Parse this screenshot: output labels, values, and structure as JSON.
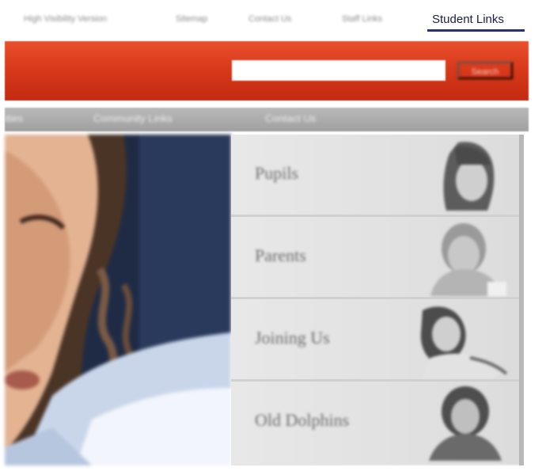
{
  "top_links": [
    {
      "label": "High Visibility Version"
    },
    {
      "label": "Sitemap"
    },
    {
      "label": "Contact Us"
    },
    {
      "label": "Staff Links"
    },
    {
      "label": "Student Links",
      "active": true
    }
  ],
  "header": {
    "search_value": "",
    "search_button": "Search"
  },
  "nav": {
    "items": [
      "ities",
      "Community Links",
      "Contact Us"
    ]
  },
  "audience": [
    {
      "label": "Pupils"
    },
    {
      "label": "Parents"
    },
    {
      "label": "Joining Us"
    },
    {
      "label": "Old Dolphins"
    }
  ],
  "colors": {
    "header_red": "#d93a1b",
    "nav_grey": "#a8a8a8",
    "active_link_underline": "#2a2f78"
  }
}
